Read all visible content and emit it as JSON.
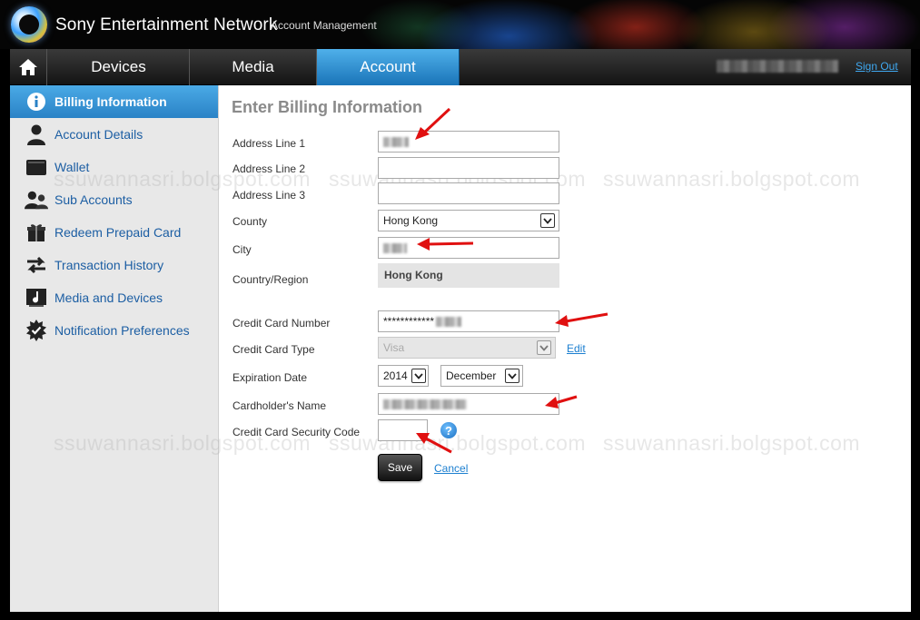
{
  "header": {
    "brand": "Sony Entertainment Network",
    "subtitle": "Account Management"
  },
  "nav": {
    "home_icon": "home-icon",
    "tabs": [
      {
        "label": "Devices",
        "active": false
      },
      {
        "label": "Media",
        "active": false
      },
      {
        "label": "Account",
        "active": true
      }
    ],
    "sign_out": "Sign Out"
  },
  "sidebar": {
    "items": [
      {
        "label": "Billing Information",
        "icon": "info-icon",
        "active": true
      },
      {
        "label": "Account Details",
        "icon": "person-icon",
        "active": false
      },
      {
        "label": "Wallet",
        "icon": "wallet-icon",
        "active": false
      },
      {
        "label": "Sub Accounts",
        "icon": "users-icon",
        "active": false
      },
      {
        "label": "Redeem Prepaid Card",
        "icon": "gift-icon",
        "active": false
      },
      {
        "label": "Transaction History",
        "icon": "transfer-arrows-icon",
        "active": false
      },
      {
        "label": "Media and Devices",
        "icon": "music-note-icon",
        "active": false
      },
      {
        "label": "Notification Preferences",
        "icon": "gear-badge-icon",
        "active": false
      }
    ]
  },
  "form": {
    "title": "Enter Billing Information",
    "address1_label": "Address Line 1",
    "address2_label": "Address Line 2",
    "address3_label": "Address Line 3",
    "county_label": "County",
    "county_value": "Hong Kong",
    "city_label": "City",
    "country_label": "Country/Region",
    "country_value": "Hong Kong",
    "cc_number_label": "Credit Card Number",
    "cc_number_value": "************",
    "cc_type_label": "Credit Card Type",
    "cc_type_value": "Visa",
    "edit_link": "Edit",
    "exp_label": "Expiration Date",
    "exp_year": "2014",
    "exp_month": "December",
    "holder_label": "Cardholder's Name",
    "cvv_label": "Credit Card Security Code",
    "help_icon": "question-icon",
    "save": "Save",
    "cancel": "Cancel"
  },
  "watermark": "ssuwannasri.bolgspot.com",
  "colors": {
    "accent": "#2a82c6",
    "link": "#1c7fd0",
    "annotation_arrow": "#e01010"
  }
}
